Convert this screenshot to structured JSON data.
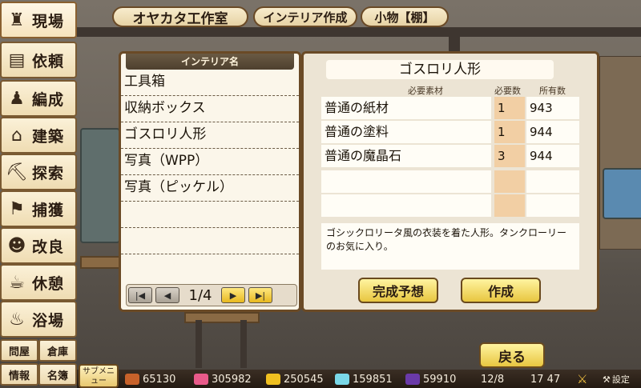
{
  "header": {
    "workshop_name": "オヤカタ工作室",
    "mode": "インテリア作成",
    "category": "小物【棚】"
  },
  "menu": [
    {
      "label": "現場",
      "icon": "tower-icon",
      "glyph": "♜"
    },
    {
      "label": "依頼",
      "icon": "notice-icon",
      "glyph": "▤"
    },
    {
      "label": "編成",
      "icon": "team-icon",
      "glyph": "♟"
    },
    {
      "label": "建築",
      "icon": "build-icon",
      "glyph": "⌂"
    },
    {
      "label": "探索",
      "icon": "boot-icon",
      "glyph": "⛏"
    },
    {
      "label": "捕獲",
      "icon": "net-icon",
      "glyph": "⚑"
    },
    {
      "label": "改良",
      "icon": "worker-icon",
      "glyph": "☻"
    },
    {
      "label": "休憩",
      "icon": "cup-icon",
      "glyph": "☕"
    },
    {
      "label": "浴場",
      "icon": "bath-icon",
      "glyph": "♨"
    }
  ],
  "small_menu": [
    "問屋",
    "倉庫",
    "情報",
    "名簿"
  ],
  "list": {
    "header": "インテリア名",
    "items": [
      "工具箱",
      "収納ボックス",
      "ゴスロリ人形",
      "写真（WPP）",
      "写真（ピッケル）",
      "",
      "",
      ""
    ],
    "page": "1/4"
  },
  "detail": {
    "name": "ゴスロリ人形",
    "col_material": "必要素材",
    "col_need": "必要数",
    "col_have": "所有数",
    "materials": [
      {
        "name": "普通の紙材",
        "need": "1",
        "have": "943"
      },
      {
        "name": "普通の塗料",
        "need": "1",
        "have": "944"
      },
      {
        "name": "普通の魔晶石",
        "need": "3",
        "have": "944"
      },
      {
        "name": "",
        "need": "",
        "have": ""
      },
      {
        "name": "",
        "need": "",
        "have": ""
      }
    ],
    "description": "ゴシックロリータ風の衣装を着た人形。タンクローリーのお気に入り。",
    "preview_button": "完成予想",
    "create_button": "作成"
  },
  "back_button": "戻る",
  "sub_menu": "サブメニュー",
  "resources": [
    {
      "icon": "meat-icon",
      "value": "65130",
      "color": "#c8622a"
    },
    {
      "icon": "food-icon",
      "value": "305982",
      "color": "#e85a8a"
    },
    {
      "icon": "gold-icon",
      "value": "250545",
      "color": "#f0c020"
    },
    {
      "icon": "crystal-icon",
      "value": "159851",
      "color": "#7ad8e8"
    },
    {
      "icon": "hat-icon",
      "value": "59910",
      "color": "#6a3aa8"
    }
  ],
  "date": "12/8",
  "time": "17 47",
  "settings_label": "設定"
}
